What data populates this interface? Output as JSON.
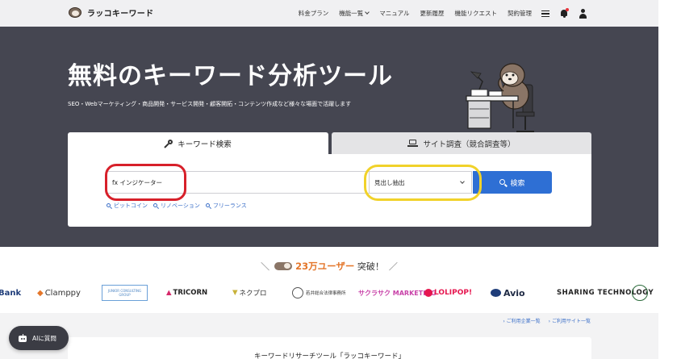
{
  "header": {
    "logo_text": "ラッコキーワード",
    "nav": [
      "料金プラン",
      "機能一覧",
      "マニュアル",
      "更新履歴",
      "機能リクエスト",
      "契約管理"
    ]
  },
  "hero": {
    "title": "無料のキーワード分析ツール",
    "subtitle": "SEO・Webマーケティング・商品開発・サービス開発・顧客開拓・コンテンツ作成など様々な場面で活躍します"
  },
  "tabs": {
    "keyword": "キーワード検索",
    "site": "サイト調査（競合調査等）"
  },
  "search": {
    "query": "fx インジケーター",
    "mode": "見出し抽出",
    "button": "検索",
    "suggestions": [
      "ビットコイン",
      "リノベーション",
      "フリーランス"
    ]
  },
  "users": {
    "count": "23万ユーザー",
    "suffix": "突破！",
    "logos": [
      "Bank",
      "Clamppy",
      "JUNIOR CONSULTING GROUP",
      "TRICORN",
      "ネクプロ",
      "若井総合法律事務所",
      "サクラサク MARKETING",
      "LOLIPOP!",
      "Avio",
      "SHARING TECHNOLOGY"
    ]
  },
  "links": {
    "companies": "ご利用企業一覧",
    "sites": "ご利用サイト一覧"
  },
  "bottom": {
    "title": "キーワードリサーチツール「ラッコキーワード」"
  },
  "ai_button": "AIに質問",
  "colors": {
    "hero_bg": "#454651",
    "accent_blue": "#2e6fd4",
    "accent_orange": "#e4762a",
    "annotation_red": "#d7202a",
    "annotation_yellow": "#f1d22a"
  }
}
